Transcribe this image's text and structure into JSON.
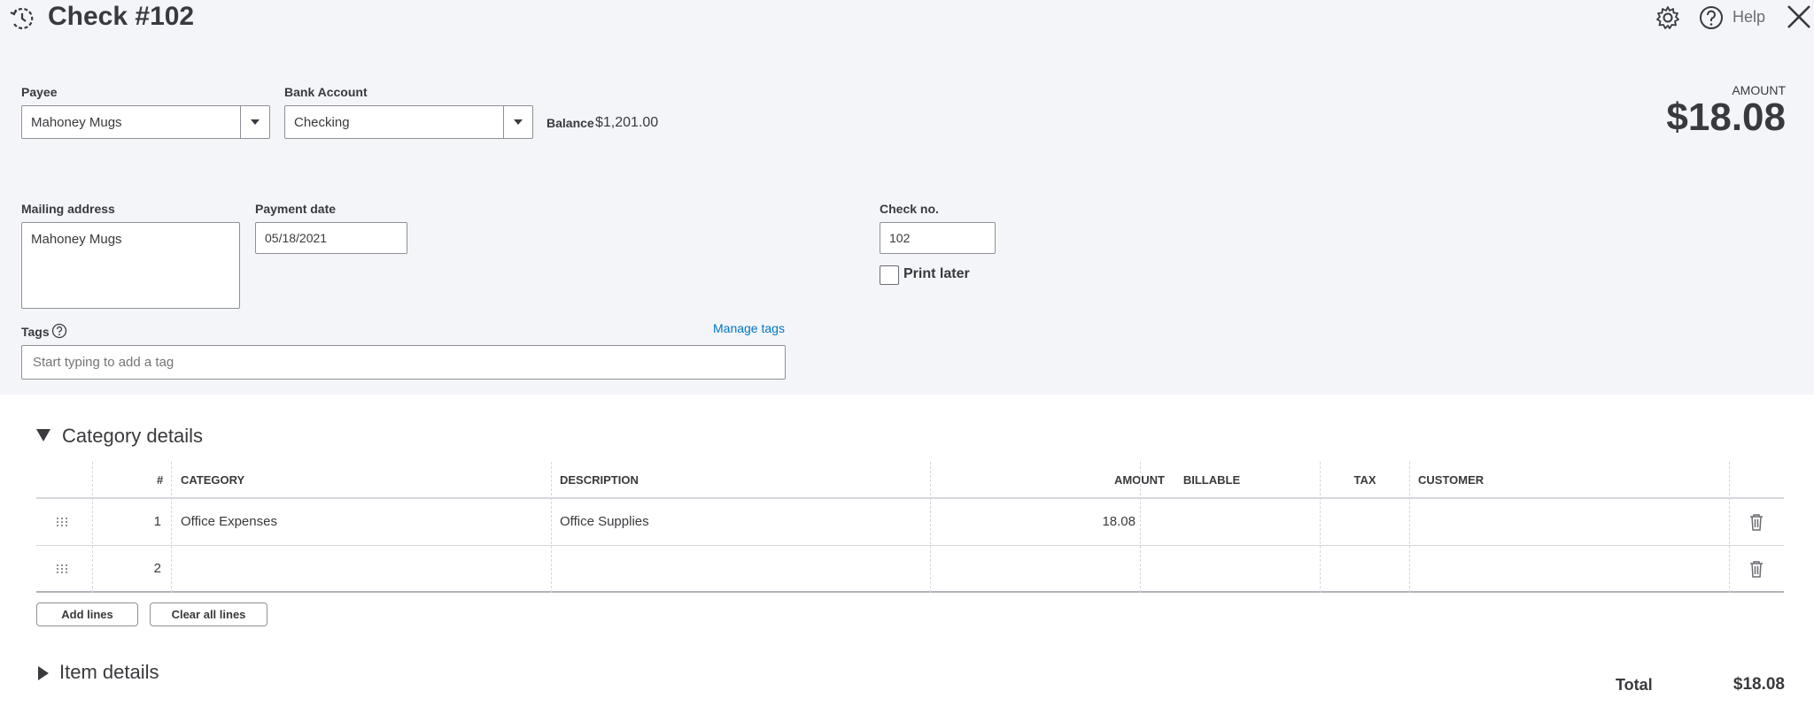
{
  "header": {
    "title": "Check #102",
    "help_label": "Help",
    "icons": {
      "history": "history-icon",
      "settings": "gear-icon",
      "help": "help-circle-icon",
      "close": "close-icon"
    }
  },
  "payee": {
    "label": "Payee",
    "value": "Mahoney Mugs"
  },
  "bank_account": {
    "label": "Bank Account",
    "value": "Checking"
  },
  "balance": {
    "label": "Balance",
    "value": "$1,201.00"
  },
  "amount": {
    "label": "AMOUNT",
    "value": "$18.08"
  },
  "mailing_address": {
    "label": "Mailing address",
    "value": "Mahoney Mugs"
  },
  "payment_date": {
    "label": "Payment date",
    "value": "05/18/2021"
  },
  "check_no": {
    "label": "Check no.",
    "value": "102"
  },
  "print_later": {
    "label": "Print later",
    "checked": false
  },
  "tags": {
    "label": "Tags",
    "manage_label": "Manage tags",
    "placeholder": "Start typing to add a tag"
  },
  "category_details": {
    "title": "Category details",
    "columns": [
      "#",
      "CATEGORY",
      "DESCRIPTION",
      "AMOUNT",
      "BILLABLE",
      "TAX",
      "CUSTOMER"
    ],
    "rows": [
      {
        "num": "1",
        "category": "Office Expenses",
        "description": "Office Supplies",
        "amount": "18.08",
        "billable": "",
        "tax": "",
        "customer": ""
      },
      {
        "num": "2",
        "category": "",
        "description": "",
        "amount": "",
        "billable": "",
        "tax": "",
        "customer": ""
      }
    ],
    "add_lines_label": "Add lines",
    "clear_lines_label": "Clear all lines"
  },
  "item_details": {
    "title": "Item details"
  },
  "total": {
    "label": "Total",
    "value": "$18.08"
  },
  "colors": {
    "page_bg": "#f4f5f8",
    "text": "#393a3d",
    "link": "#0077c5"
  }
}
